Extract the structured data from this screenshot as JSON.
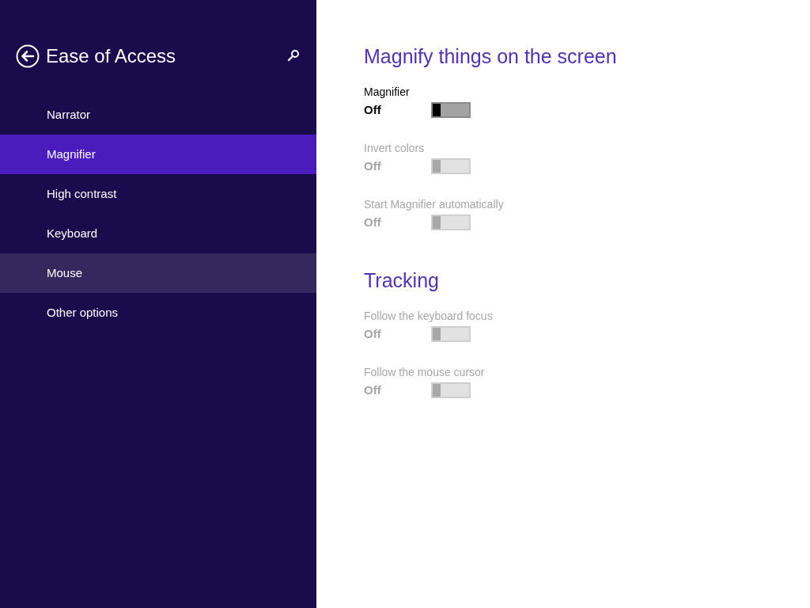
{
  "sidebar": {
    "title": "Ease of Access",
    "items": [
      {
        "label": "Narrator",
        "selected": false,
        "hovered": false
      },
      {
        "label": "Magnifier",
        "selected": true,
        "hovered": false
      },
      {
        "label": "High contrast",
        "selected": false,
        "hovered": false
      },
      {
        "label": "Keyboard",
        "selected": false,
        "hovered": false
      },
      {
        "label": "Mouse",
        "selected": false,
        "hovered": true
      },
      {
        "label": "Other options",
        "selected": false,
        "hovered": false
      }
    ]
  },
  "sections": [
    {
      "title": "Magnify things on the screen",
      "settings": [
        {
          "label": "Magnifier",
          "state_text": "Off",
          "on": false,
          "disabled": false
        },
        {
          "label": "Invert colors",
          "state_text": "Off",
          "on": false,
          "disabled": true
        },
        {
          "label": "Start Magnifier automatically",
          "state_text": "Off",
          "on": false,
          "disabled": true
        }
      ]
    },
    {
      "title": "Tracking",
      "settings": [
        {
          "label": "Follow the keyboard focus",
          "state_text": "Off",
          "on": false,
          "disabled": true
        },
        {
          "label": "Follow the mouse cursor",
          "state_text": "Off",
          "on": false,
          "disabled": true
        }
      ]
    }
  ]
}
